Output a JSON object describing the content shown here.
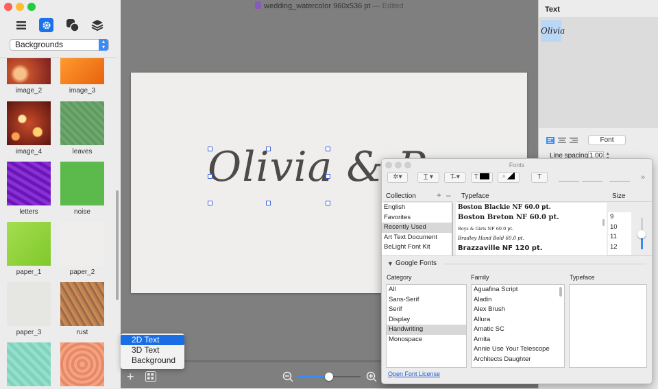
{
  "window": {
    "title": "wedding_watercolor 960x536 pt",
    "edited": " — Edited",
    "traffic_lights": [
      "#fe5f57",
      "#febc2e",
      "#28c840"
    ]
  },
  "sidebar": {
    "toolbar_icons": [
      "list-icon",
      "gear-icon",
      "shapes-icon",
      "layers-icon"
    ],
    "selected_toolbar": "gear-icon",
    "category_select": "Backgrounds",
    "backgrounds": [
      {
        "label": "image_2",
        "color": "#c14a2a"
      },
      {
        "label": "image_3",
        "color": "#f07a1a"
      },
      {
        "label": "image_4",
        "color": "#a33a1e"
      },
      {
        "label": "leaves",
        "color": "#6aa86a"
      },
      {
        "label": "letters",
        "color": "#7a22c8"
      },
      {
        "label": "noise",
        "color": "#5cba4c"
      },
      {
        "label": "paper_1",
        "color": "#8ed13a"
      },
      {
        "label": "paper_2",
        "color": "#ececea"
      },
      {
        "label": "paper_3",
        "color": "#e6e6e2"
      },
      {
        "label": "rust",
        "color": "#b07a52"
      },
      {
        "label": "",
        "color": "#8fdcc8"
      },
      {
        "label": "",
        "color": "#f09a76"
      }
    ]
  },
  "canvas": {
    "text": "Olivia & P"
  },
  "add_menu": {
    "items": [
      "2D Text",
      "3D Text",
      "Background"
    ],
    "selected": "2D Text"
  },
  "bottom_bar": {
    "zoom_level": 0.5
  },
  "right_panel": {
    "section_title": "Text",
    "text_items": [
      "Olivia"
    ],
    "font_button": "Font",
    "line_spacing_label": "Line spacing",
    "line_spacing_value": "1.00"
  },
  "fonts_panel": {
    "title": "Fonts",
    "collection_header": "Collection",
    "typeface_header": "Typeface",
    "size_header": "Size",
    "collections": [
      "English",
      "Favorites",
      "Recently Used",
      "Art Text Document",
      "BeLight Font Kit"
    ],
    "selected_collection": "Recently Used",
    "typefaces": [
      "Boston Blackie NF 60.0 pt.",
      "Boston Breton NF 60.0 pt.",
      "Boys & Girls NF 60.0 pt.",
      "Bradley Hand Bold 60.0 pt.",
      "Brazzaville NF 120 pt."
    ],
    "sizes": [
      "9",
      "10",
      "11",
      "12"
    ],
    "google_fonts_label": "Google Fonts",
    "category_header": "Category",
    "family_header": "Family",
    "typeface2_header": "Typeface",
    "categories": [
      "All",
      "Sans-Serif",
      "Serif",
      "Display",
      "Handwriting",
      "Monospace"
    ],
    "selected_category": "Handwriting",
    "families": [
      "Aguafina Script",
      "Aladin",
      "Alex Brush",
      "Allura",
      "Amatic SC",
      "Amita",
      "Annie Use Your Telescope",
      "Architects Daughter"
    ],
    "open_license": "Open Font License"
  }
}
